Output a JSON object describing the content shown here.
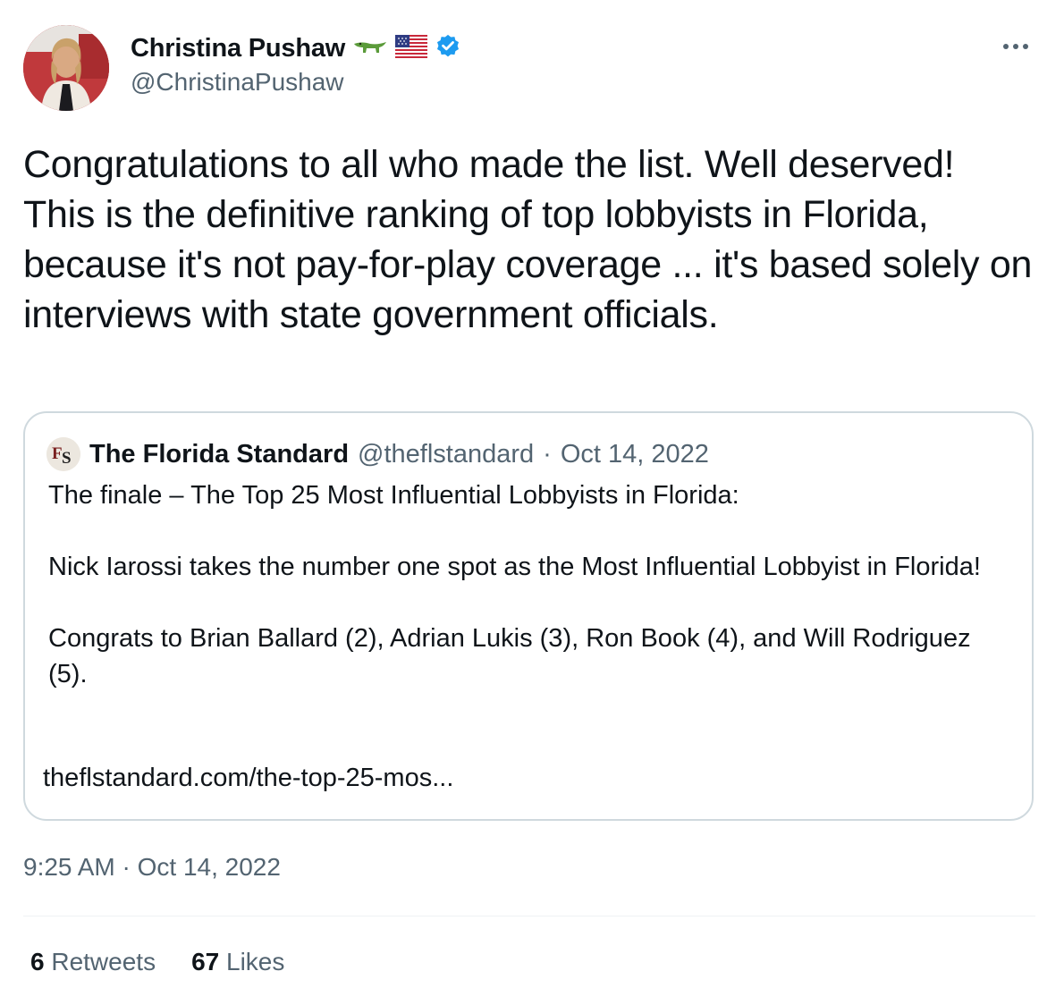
{
  "author": {
    "name": "Christina Pushaw",
    "handle": "@ChristinaPushaw",
    "emojis": [
      "alligator-emoji",
      "us-flag-emoji"
    ],
    "verified": true,
    "verified_color": "#1d9bf0"
  },
  "tweet": {
    "text": "Congratulations to all who made the list. Well deserved! This is the definitive ranking of top lobbyists in Florida, because it's not pay-for-play coverage ... it's based solely on interviews with state government officials.",
    "timestamp": "9:25 AM · Oct 14, 2022"
  },
  "quoted": {
    "name": "The Florida Standard",
    "handle": "@theflstandard",
    "date": "Oct 14, 2022",
    "separator": "·",
    "logo_text": "FS",
    "paragraphs": [
      "The finale – The Top 25 Most Influential Lobbyists in Florida:",
      "Nick Iarossi takes the number one spot as the Most Influential Lobbyist in Florida!",
      "Congrats to Brian Ballard (2), Adrian Lukis (3), Ron Book (4), and Will Rodriguez (5)."
    ],
    "link": "theflstandard.com/the-top-25-mos..."
  },
  "stats": {
    "retweets_count": "6",
    "retweets_label": "Retweets",
    "likes_count": "67",
    "likes_label": "Likes"
  },
  "colors": {
    "text": "#0f1419",
    "secondary": "#536471",
    "border": "#cfd9de"
  }
}
